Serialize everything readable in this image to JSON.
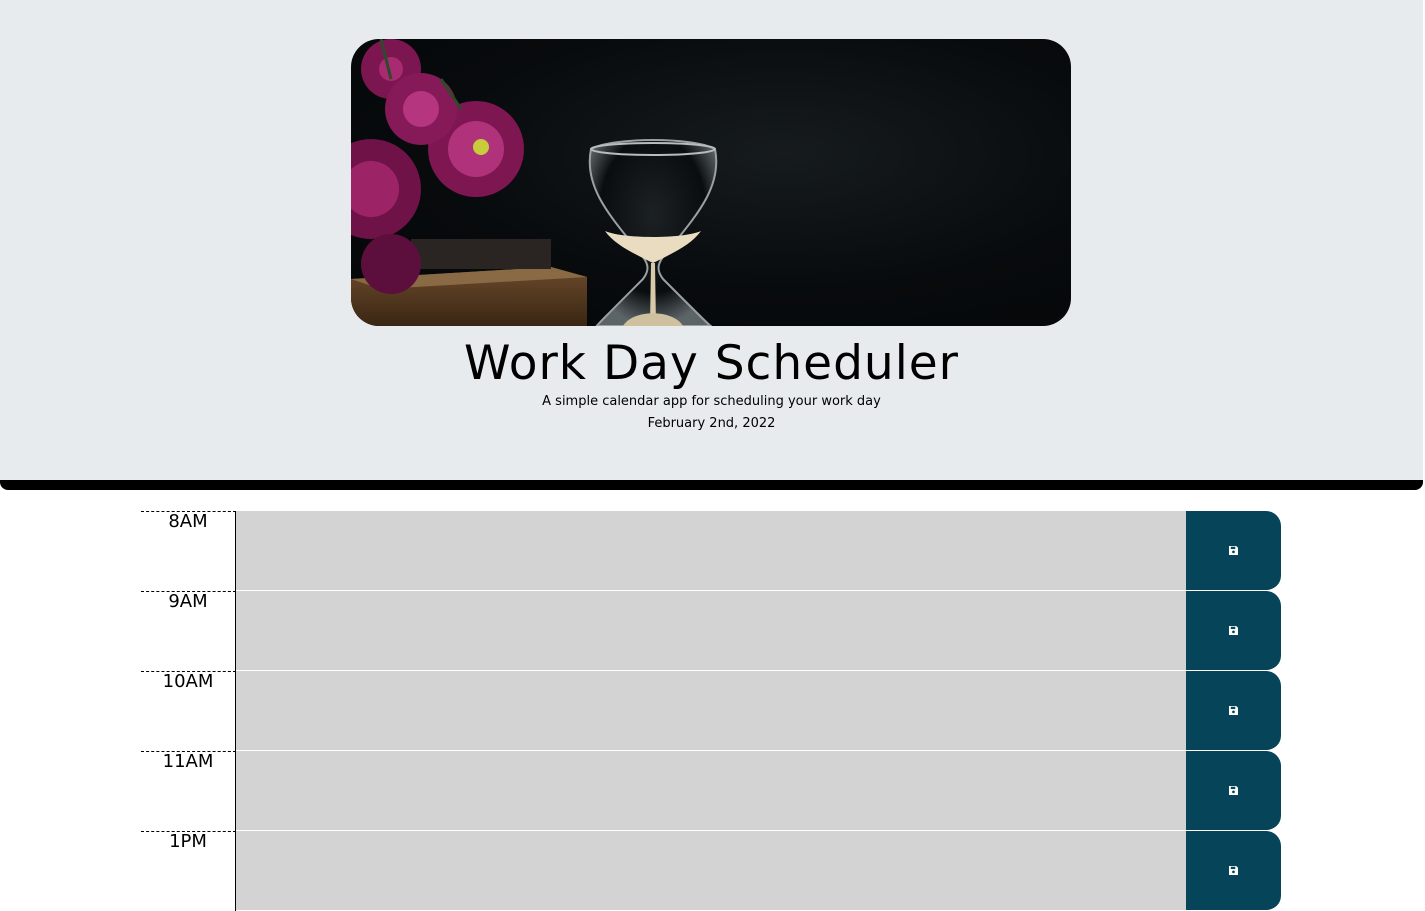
{
  "header": {
    "title": "Work Day Scheduler",
    "lead": "A simple calendar app for scheduling your work day",
    "current_day": "February 2nd, 2022",
    "hero_image": "hourglass-with-flowers-photo"
  },
  "planner": {
    "rows": [
      {
        "hour": "8AM",
        "text": "",
        "save_icon": "floppy-disk-icon"
      },
      {
        "hour": "9AM",
        "text": "",
        "save_icon": "floppy-disk-icon"
      },
      {
        "hour": "10AM",
        "text": "",
        "save_icon": "floppy-disk-icon"
      },
      {
        "hour": "11AM",
        "text": "",
        "save_icon": "floppy-disk-icon"
      },
      {
        "hour": "1PM",
        "text": "",
        "save_icon": "floppy-disk-icon"
      }
    ]
  },
  "colors": {
    "header_bg": "#e8ebee",
    "header_border": "#000000",
    "time_block_bg": "#d3d3d3",
    "save_button_bg": "#06445a",
    "save_icon": "#ffffff"
  }
}
